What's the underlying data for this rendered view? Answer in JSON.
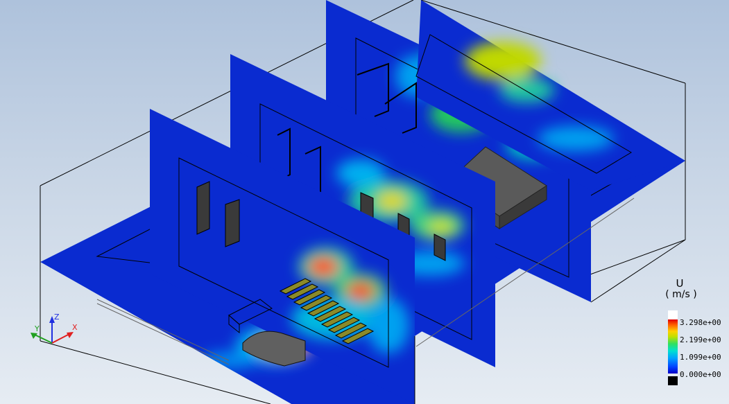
{
  "legend": {
    "variable": "U",
    "unit": "( m/s )",
    "ticks": [
      "3.298e+00",
      "2.199e+00",
      "1.099e+00",
      "0.000e+00"
    ],
    "max_color": "#ffffff",
    "min_color": "#000000"
  },
  "triad": {
    "x_label": "X",
    "y_label": "Y",
    "z_label": "Z"
  },
  "colors": {
    "background_top": "#aec2dc",
    "plane_base": "#0a2bd0",
    "low": "#0000c8",
    "high": "#e00000",
    "x_axis": "#e02020",
    "y_axis": "#20a020",
    "z_axis": "#2030e0"
  }
}
